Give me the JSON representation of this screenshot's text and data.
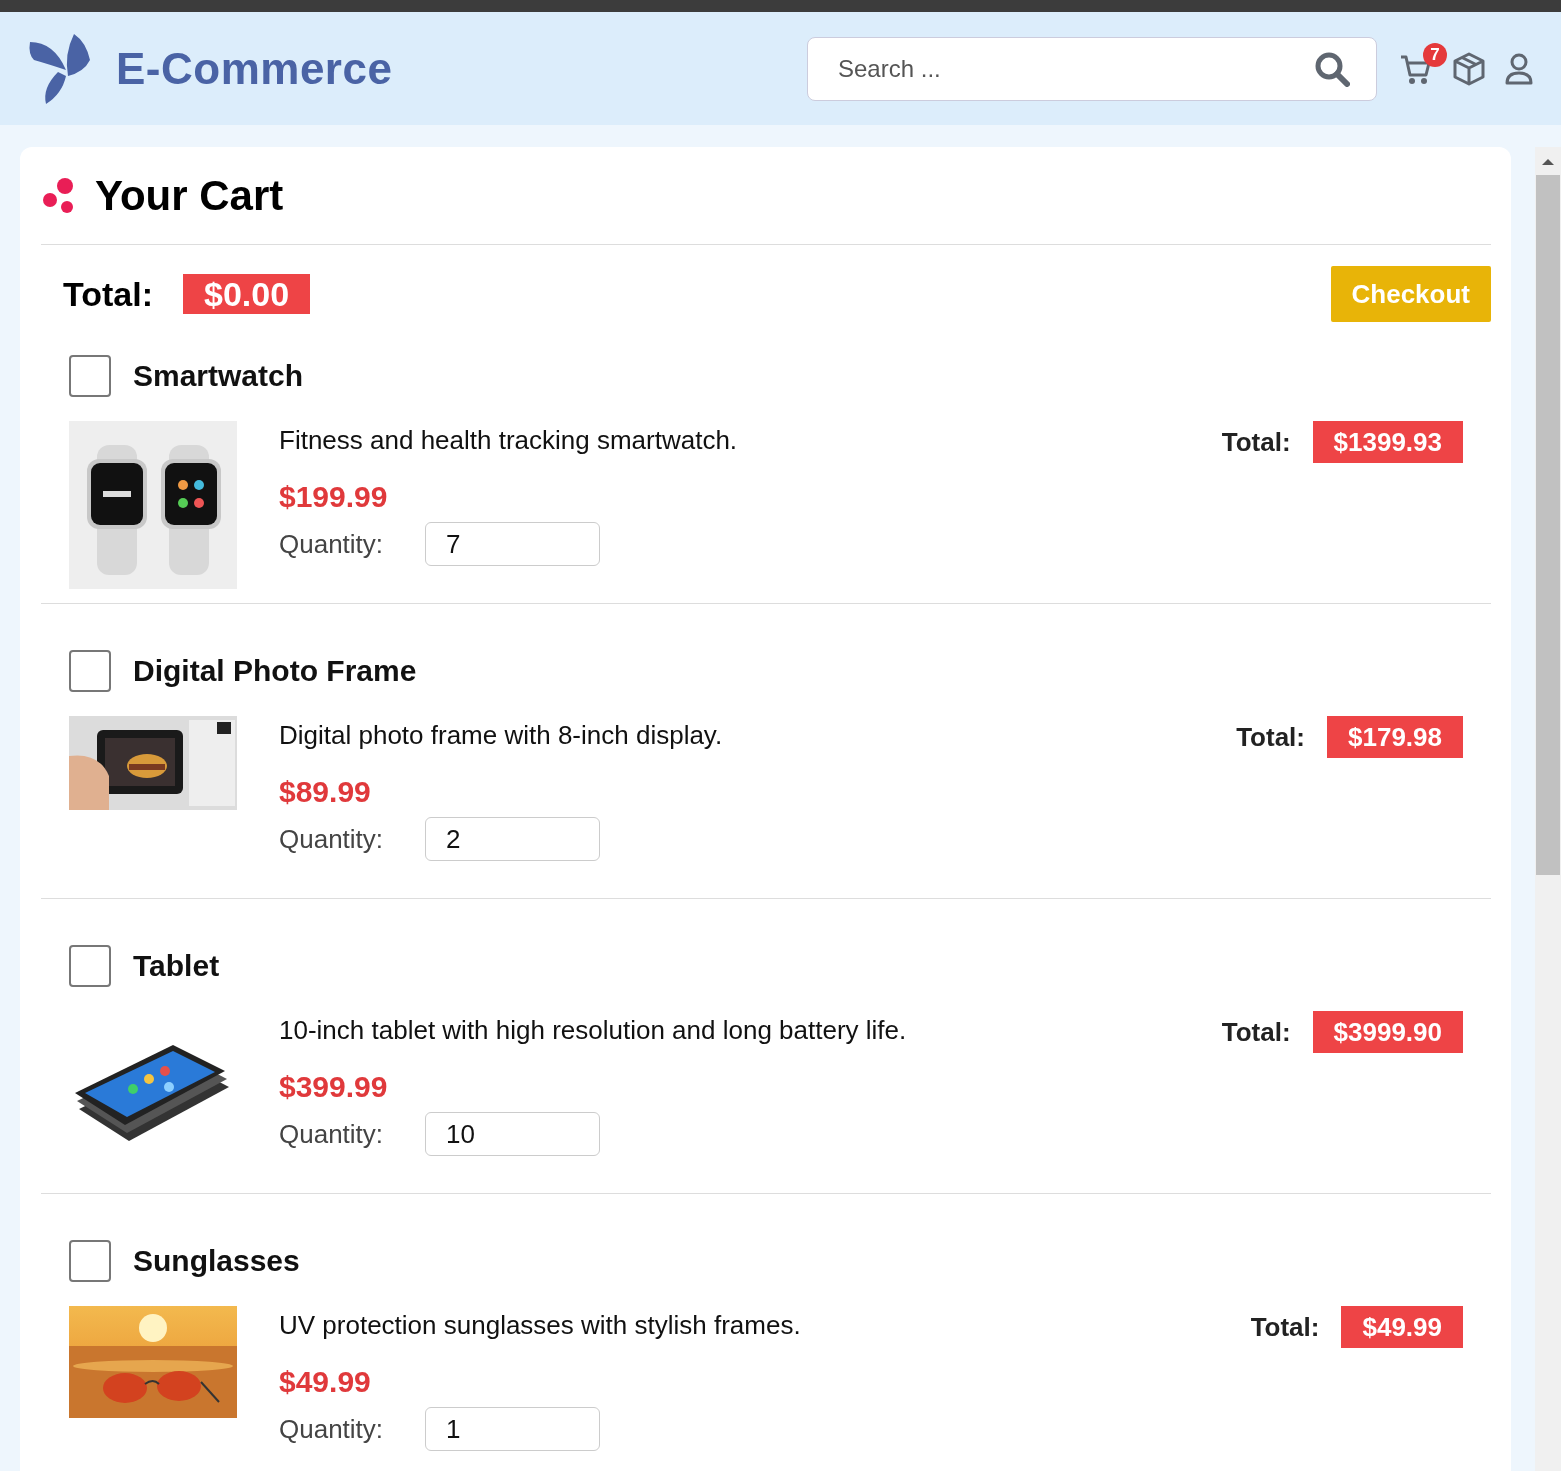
{
  "header": {
    "brand": "E-Commerce",
    "search": {
      "placeholder": "Search ..."
    },
    "cart_badge": "7"
  },
  "cart": {
    "title": "Your Cart",
    "total_label": "Total:",
    "total": "$0.00",
    "checkout": "Checkout",
    "items": [
      {
        "name": "Smartwatch",
        "checked": false,
        "description": "Fitness and health tracking smartwatch.",
        "price": "$199.99",
        "quantity_label": "Quantity:",
        "quantity": "7",
        "total_label": "Total:",
        "total": "$1399.93"
      },
      {
        "name": "Digital Photo Frame",
        "checked": false,
        "description": "Digital photo frame with 8-inch display.",
        "price": "$89.99",
        "quantity_label": "Quantity:",
        "quantity": "2",
        "total_label": "Total:",
        "total": "$179.98"
      },
      {
        "name": "Tablet",
        "checked": false,
        "description": "10-inch tablet with high resolution and long battery life.",
        "price": "$399.99",
        "quantity_label": "Quantity:",
        "quantity": "10",
        "total_label": "Total:",
        "total": "$3999.90"
      },
      {
        "name": "Sunglasses",
        "checked": false,
        "description": "UV protection sunglasses with stylish frames.",
        "price": "$49.99",
        "quantity_label": "Quantity:",
        "quantity": "1",
        "total_label": "Total:",
        "total": "$49.99"
      }
    ]
  }
}
